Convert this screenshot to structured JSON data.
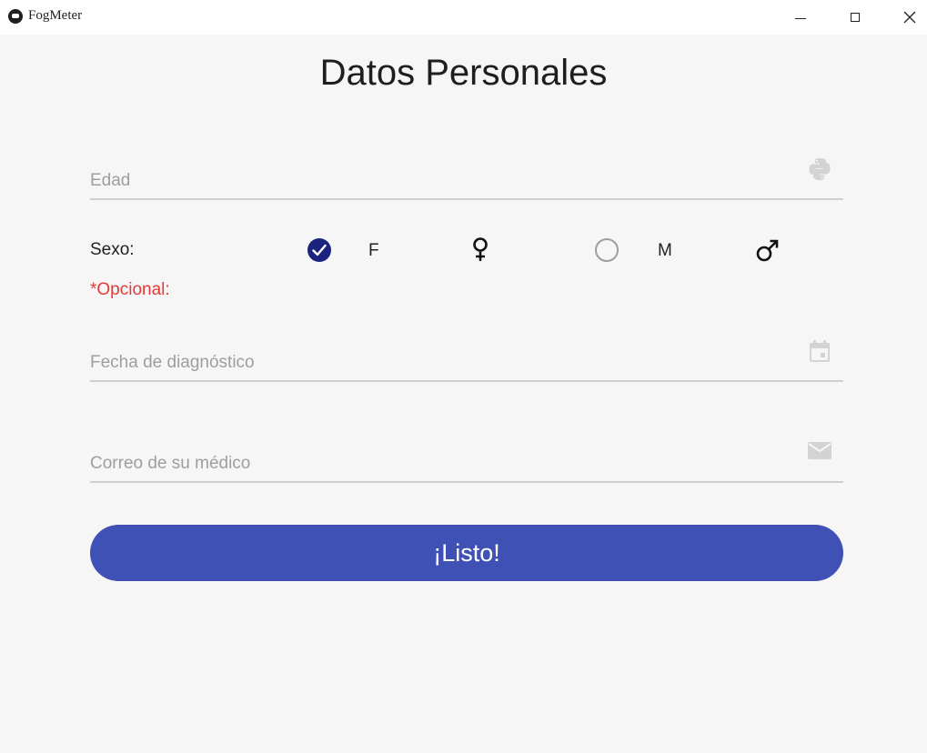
{
  "window": {
    "title": "FogMeter"
  },
  "page": {
    "title": "Datos Personales"
  },
  "form": {
    "edad": {
      "placeholder": "Edad",
      "value": "",
      "icon": "python-icon"
    },
    "sexo": {
      "label": "Sexo:",
      "options": [
        {
          "letter": "F",
          "selected": true,
          "icon": "female-icon"
        },
        {
          "letter": "M",
          "selected": false,
          "icon": "male-icon"
        }
      ]
    },
    "opcional_label": "*Opcional:",
    "fecha": {
      "placeholder": "Fecha de diagnóstico",
      "value": "",
      "icon": "calendar-icon"
    },
    "correo": {
      "placeholder": "Correo de su médico",
      "value": "",
      "icon": "email-icon"
    },
    "submit_label": "¡Listo!"
  },
  "colors": {
    "accent": "#3f51b5",
    "radio_selected": "#1a237e",
    "optional_text": "#e53935"
  }
}
